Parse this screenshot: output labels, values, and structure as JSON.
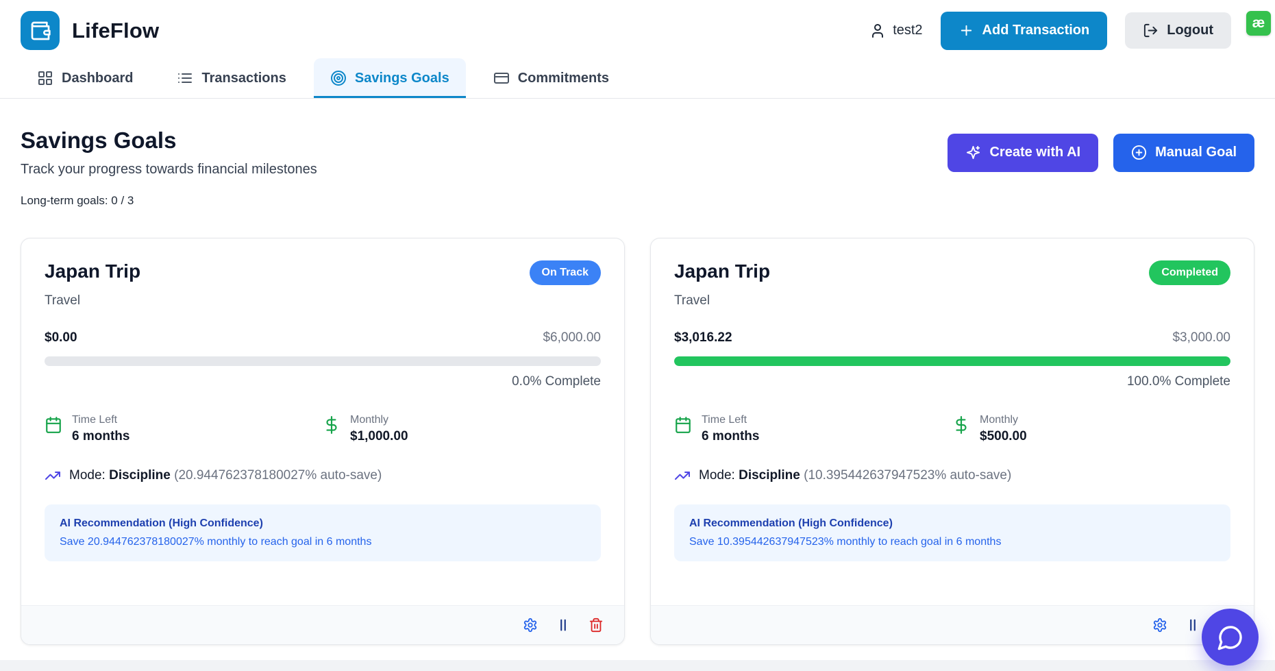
{
  "header": {
    "app_name": "LifeFlow",
    "username": "test2",
    "add_transaction_label": "Add Transaction",
    "logout_label": "Logout",
    "extension_badge": "æ"
  },
  "tabs": [
    {
      "label": "Dashboard",
      "active": false
    },
    {
      "label": "Transactions",
      "active": false
    },
    {
      "label": "Savings Goals",
      "active": true
    },
    {
      "label": "Commitments",
      "active": false
    }
  ],
  "page": {
    "title": "Savings Goals",
    "subtitle": "Track your progress towards financial milestones",
    "goal_count": "Long-term goals: 0 / 3",
    "create_ai_label": "Create with AI",
    "manual_goal_label": "Manual Goal"
  },
  "goals": [
    {
      "name": "Japan Trip",
      "category": "Travel",
      "status": "On Track",
      "status_color": "#3b82f6",
      "current": "$0.00",
      "target": "$6,000.00",
      "progress_pct": 0,
      "progress_label": "0.0% Complete",
      "time_left_label": "Time Left",
      "time_left": "6 months",
      "monthly_label": "Monthly",
      "monthly": "$1,000.00",
      "mode_prefix": "Mode:",
      "mode": "Discipline",
      "mode_detail": "(20.944762378180027% auto-save)",
      "ai_title": "AI Recommendation (High Confidence)",
      "ai_text": "Save 20.944762378180027% monthly to reach goal in 6 months"
    },
    {
      "name": "Japan Trip",
      "category": "Travel",
      "status": "Completed",
      "status_color": "#22c55e",
      "current": "$3,016.22",
      "target": "$3,000.00",
      "progress_pct": 100,
      "progress_label": "100.0% Complete",
      "time_left_label": "Time Left",
      "time_left": "6 months",
      "monthly_label": "Monthly",
      "monthly": "$500.00",
      "mode_prefix": "Mode:",
      "mode": "Discipline",
      "mode_detail": "(10.395442637947523% auto-save)",
      "ai_title": "AI Recommendation (High Confidence)",
      "ai_text": "Save 10.395442637947523% monthly to reach goal in 6 months"
    }
  ],
  "colors": {
    "brand_blue": "#0d87c9",
    "ai_purple": "#4f46e5",
    "manual_blue": "#2563eb",
    "progress_green": "#22c55e",
    "extension_green": "#35c14d"
  },
  "icons": {
    "logo": "wallet-icon",
    "user": "user-icon",
    "add_transaction": "plus-icon",
    "logout": "log-out-icon",
    "dashboard": "grid-icon",
    "transactions": "list-icon",
    "savings_goals": "target-icon",
    "commitments": "credit-card-icon",
    "create_ai": "sparkles-icon",
    "manual_goal": "plus-circle-icon",
    "time_left": "calendar-icon",
    "monthly": "dollar-icon",
    "mode": "trending-up-icon",
    "card_settings": "gear-icon",
    "card_pause": "pause-icon",
    "card_delete": "trash-icon",
    "chat": "chat-bubble-icon"
  }
}
